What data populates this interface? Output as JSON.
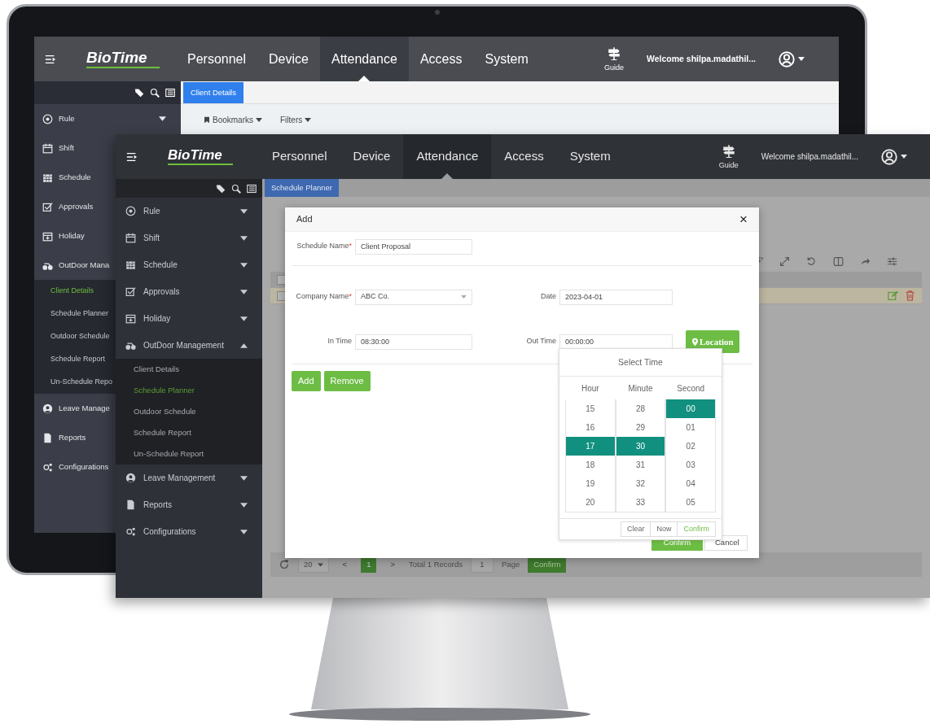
{
  "back_window": {
    "navbar": {
      "logo": "BioTime",
      "menu": [
        {
          "label": "Personnel",
          "selected": false
        },
        {
          "label": "Device",
          "selected": false
        },
        {
          "label": "Attendance",
          "selected": true
        },
        {
          "label": "Access",
          "selected": false
        },
        {
          "label": "System",
          "selected": false
        }
      ],
      "guide": "Guide",
      "welcome": "Welcome shilpa.madathil..."
    },
    "sidebar": [
      {
        "label": "Rule",
        "expanded": false
      },
      {
        "label": "Shift"
      },
      {
        "label": "Schedule"
      },
      {
        "label": "Approvals"
      },
      {
        "label": "Holiday"
      },
      {
        "label": "OutDoor Mana",
        "children": [
          {
            "label": "Client Details",
            "selected": true
          },
          {
            "label": "Schedule Planner",
            "selected": false
          },
          {
            "label": "Outdoor Schedule",
            "selected": false
          },
          {
            "label": "Schedule Report",
            "selected": false
          },
          {
            "label": "Un-Schedule Repo",
            "selected": false
          }
        ]
      },
      {
        "label": "Leave Manage"
      },
      {
        "label": "Reports"
      },
      {
        "label": "Configurations"
      }
    ],
    "tabs": [
      {
        "label": "Client Details",
        "selected": true
      }
    ],
    "toolbar": [
      {
        "label": "Bookmarks"
      },
      {
        "label": "Filters"
      }
    ]
  },
  "front_window": {
    "navbar": {
      "logo": "BioTime",
      "menu": [
        {
          "label": "Personnel",
          "selected": false
        },
        {
          "label": "Device",
          "selected": false
        },
        {
          "label": "Attendance",
          "selected": true
        },
        {
          "label": "Access",
          "selected": false
        },
        {
          "label": "System",
          "selected": false
        }
      ],
      "guide": "Guide",
      "welcome": "Welcome shilpa.madathil..."
    },
    "sidebar": [
      {
        "label": "Rule",
        "expanded": false
      },
      {
        "label": "Shift",
        "expanded": false
      },
      {
        "label": "Schedule",
        "expanded": false
      },
      {
        "label": "Approvals",
        "expanded": false
      },
      {
        "label": "Holiday",
        "expanded": false
      },
      {
        "label": "OutDoor Management",
        "expanded": true,
        "children": [
          {
            "label": "Client Details",
            "selected": false
          },
          {
            "label": "Schedule Planner",
            "selected": true
          },
          {
            "label": "Outdoor Schedule",
            "selected": false
          },
          {
            "label": "Schedule Report",
            "selected": false
          },
          {
            "label": "Un-Schedule Report",
            "selected": false
          }
        ]
      },
      {
        "label": "Leave Management",
        "expanded": false
      },
      {
        "label": "Reports",
        "expanded": false
      },
      {
        "label": "Configurations",
        "expanded": false
      }
    ],
    "tabs": [
      {
        "label": "Schedule Planner",
        "selected": true
      }
    ],
    "table": {
      "header_checked": false,
      "rows": [
        {
          "checked": false,
          "selected": true
        }
      ]
    },
    "pagination": {
      "page_size": "20",
      "prev": "<",
      "pages": [
        {
          "label": "1",
          "selected": true
        }
      ],
      "next": ">",
      "total": "Total 1 Records",
      "page_input": "1",
      "page_label": "Page",
      "go": "Confirm"
    },
    "dialog": {
      "title": "Add",
      "close": "×",
      "rows": [
        {
          "fields": [
            {
              "label": "Schedule Name",
              "mark": "*",
              "kind": "text",
              "value": "Client Proposal"
            }
          ]
        },
        {
          "fields": [
            {
              "label": "Company Name",
              "mark": "*",
              "kind": "select",
              "value": "ABC Co."
            },
            {
              "label": "Date",
              "kind": "text",
              "value": "2023-04-01"
            }
          ]
        },
        {
          "fields": [
            {
              "label": "In Time",
              "kind": "text",
              "value": "08:30:00"
            },
            {
              "label": "Out Time",
              "kind": "text",
              "value": "00:00:00"
            }
          ],
          "button": "Location"
        }
      ],
      "row_buttons": [
        "Add",
        "Remove"
      ],
      "footer_buttons": [
        {
          "label": "Confirm",
          "kind": "primary"
        },
        {
          "label": "Cancel",
          "kind": "secondary"
        }
      ],
      "time_picker": {
        "title": "Select Time",
        "columns": [
          {
            "heading": "Hour",
            "options": [
              {
                "label": "15",
                "selected": false
              },
              {
                "label": "16",
                "selected": false
              },
              {
                "label": "17",
                "selected": true
              },
              {
                "label": "18",
                "selected": false
              },
              {
                "label": "19",
                "selected": false
              },
              {
                "label": "20",
                "selected": false
              }
            ]
          },
          {
            "heading": "Minute",
            "options": [
              {
                "label": "28",
                "selected": false
              },
              {
                "label": "29",
                "selected": false
              },
              {
                "label": "30",
                "selected": true
              },
              {
                "label": "31",
                "selected": false
              },
              {
                "label": "32",
                "selected": false
              },
              {
                "label": "33",
                "selected": false
              }
            ]
          },
          {
            "heading": "Second",
            "options": [
              {
                "label": "00",
                "selected": true
              },
              {
                "label": "01",
                "selected": false
              },
              {
                "label": "02",
                "selected": false
              },
              {
                "label": "03",
                "selected": false
              },
              {
                "label": "04",
                "selected": false
              },
              {
                "label": "05",
                "selected": false
              }
            ]
          }
        ],
        "buttons": [
          {
            "label": "Clear",
            "kind": "plain"
          },
          {
            "label": "Now",
            "kind": "plain"
          },
          {
            "label": "Confirm",
            "kind": "primary"
          }
        ]
      }
    }
  }
}
